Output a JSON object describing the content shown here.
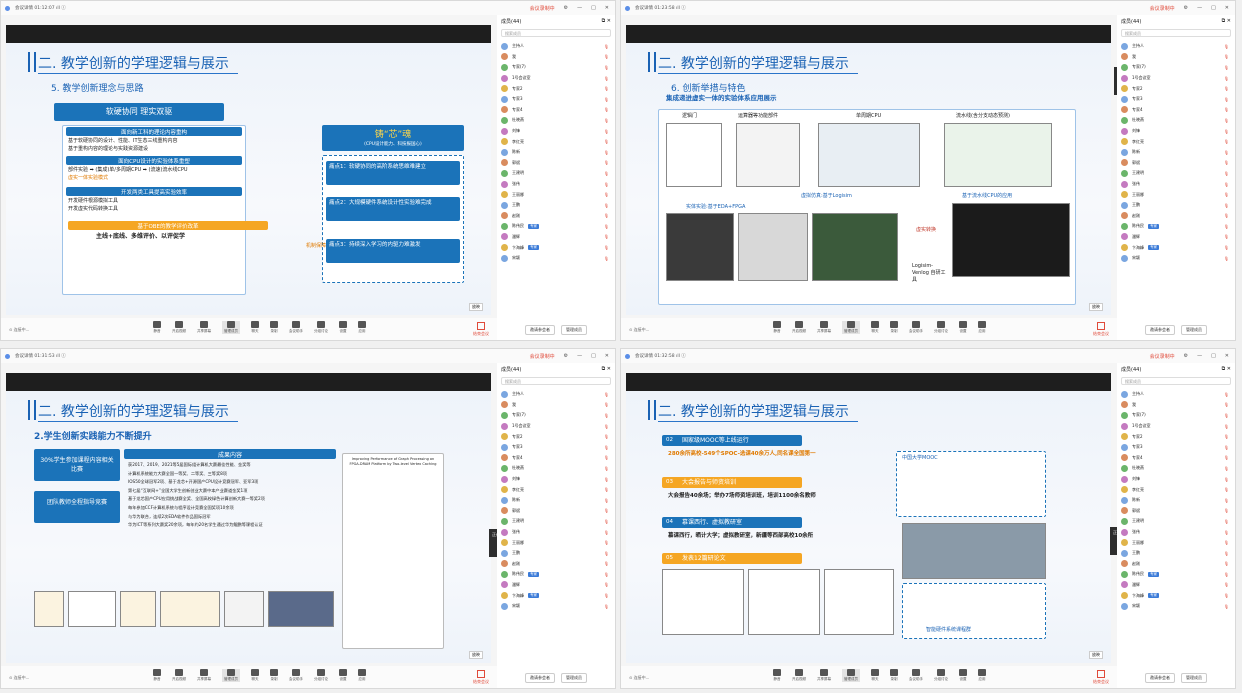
{
  "meeting": {
    "search_placeholder": "搜索成员",
    "participants_label": "成员(44)",
    "foot_btn_invite": "邀请参会者",
    "foot_btn_manage": "管理成员",
    "record_label": "会议录制中",
    "float_label": "正在讲话：",
    "float_name": "专家(7)",
    "end_label": "结束会议",
    "page_label": "放映",
    "toolbar_items": [
      "静音",
      "开启视频",
      "共享屏幕",
      "管理成员",
      "聊天",
      "录制",
      "会议助手",
      "分组讨论",
      "设置",
      "应用"
    ]
  },
  "members": [
    {
      "name": "主持人",
      "tag": ""
    },
    {
      "name": "我",
      "tag": ""
    },
    {
      "name": "专家(7)",
      "tag": ""
    },
    {
      "name": "1号会议室",
      "tag": ""
    },
    {
      "name": "专家2",
      "tag": ""
    },
    {
      "name": "专家3",
      "tag": ""
    },
    {
      "name": "专家4",
      "tag": ""
    },
    {
      "name": "杜晓燕",
      "tag": ""
    },
    {
      "name": "刘锋",
      "tag": ""
    },
    {
      "name": "李红亮",
      "tag": ""
    },
    {
      "name": "陈新",
      "tag": ""
    },
    {
      "name": "郭斌",
      "tag": ""
    },
    {
      "name": "王建明",
      "tag": ""
    },
    {
      "name": "张伟",
      "tag": ""
    },
    {
      "name": "王丽娜",
      "tag": ""
    },
    {
      "name": "王鹏",
      "tag": ""
    },
    {
      "name": "赵刚",
      "tag": ""
    },
    {
      "name": "陈伟民",
      "tag": "专家"
    },
    {
      "name": "潘辉",
      "tag": ""
    },
    {
      "name": "卞海峰",
      "tag": "专家"
    },
    {
      "name": "宋颖",
      "tag": ""
    }
  ],
  "slide_title": "二. 教学创新的学理逻辑与展示",
  "slide1": {
    "subtitle": "5. 教学创新理念与思路",
    "left_header": "软硬协同 理实双驱",
    "sec1": "面向新工科的理论内容重构",
    "sec1_items": [
      "基于软硬协同的设计、性能、IT生态三线重构内容",
      "基于重构内容的理论与实践资源建设"
    ],
    "sec2": "面向CPU设计的实验体系重塑",
    "sec2_items": [
      "部件实验 ➡ (集成)单/多周期CPU ➡ (流速)流水线CPU",
      "虚实一体实验模式"
    ],
    "sec3": "开发两类工具提高实验效率",
    "sec3_items": [
      "开发硬件根源模拟工具",
      "开发虚实代码转换工具"
    ],
    "obe": "基于OBE的教学评价改革",
    "obe_sub": "主线+底线、多维评价、以评促学",
    "right_header": "铸“芯”魂",
    "right_sub": "(CPU设计能力、科技报国心)",
    "pain1": "痛点1：软硬协同的高阶系统思维难建立",
    "pain2": "痛点2：大规模硬件系统设计性实验难完成",
    "pain3": "痛点3：持续深入学习的内驱力难激发",
    "mech": "机制保障"
  },
  "slide2": {
    "subtitle": "6. 创新举措与特色",
    "heading": "集成递进虚实一体的实验体系应用展示",
    "labels": [
      "逻辑门",
      "运算器等功能部件",
      "单周期CPU",
      "流水线(含分支动态预测)"
    ],
    "sim": "虚拟仿真:基于Logisim",
    "real": "实体实验:基于EDA+FPGA",
    "convert": "虚实转换",
    "tool": "Logisim-Venlog 自研工具",
    "app": "基于流水线CPU的应用"
  },
  "slide3": {
    "subtitle": "2.学生创新实践能力不断提升",
    "badge1": "30%学生参加课程内容相关比赛",
    "badge2": "团队教师全程指导竞赛",
    "table_head": "成果内容",
    "rows": [
      "获2017、2019、2021等5届国际组计算机大赛最佳性能、金奖等",
      "计算机系统能力大赛全国一等奖、二等奖、三等奖8项",
      "IOS50全球冠军2项、基于龙芯+开源国产CPU设计竞赛冠军、亚军3项",
      "第七届“互联网+”全国大学生创新创业大赛中本产业赛道金奖1项",
      "基于龙芯国产CPU应用挑战赛全奖、全国高校绿色计算创新大赛一等奖2项",
      "每年参加CCF计算机系统与程序设计竞赛全国奖项10余项",
      "与华为联合，连续2次EDA软件作品国际冠军",
      "华为ICT等系列大赛奖20余项，每年约20名学生通过华为鲲鹏等课程认证"
    ],
    "paper_title": "Improving Performance of Graph Processing on FPGA-DRAM Platform by Two-level Vertex Caching"
  },
  "slide4": {
    "p1_num": "02",
    "p1": "国家级MOOC等上线运行",
    "p1_text": "280余所高校-549个SPOC-选课40余万人,同名课全国第一",
    "p2_num": "03",
    "p2": "大会报告与师资培训",
    "p2_text": "大会报告40余场；举办7场师资培训班，培训1100余名教师",
    "p3_num": "04",
    "p3": "慕课西行、虚拟教研室",
    "p3_text": "慕课西行，晒计大学；虚拟教研室，新疆等西部高校10余所",
    "p4_num": "05",
    "p4": "发表12篇研论文",
    "mooc": "中国大学MOOC",
    "vlab": "智能硬件系统课程群"
  }
}
